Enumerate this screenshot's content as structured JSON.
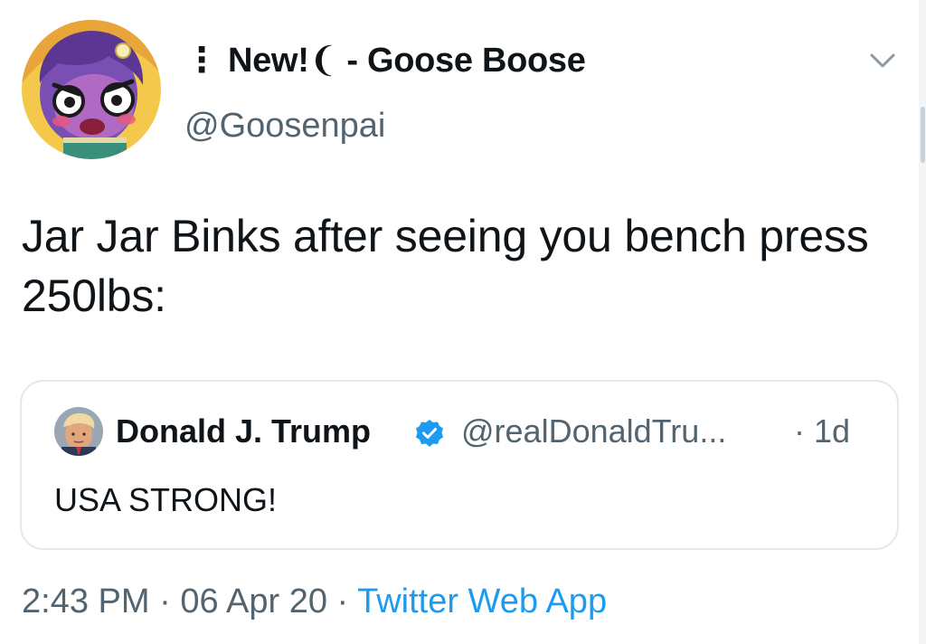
{
  "author": {
    "display_name": "⋮ New!❨ - Goose Boose",
    "handle": "@Goosenpai"
  },
  "tweet": {
    "text": "Jar Jar Binks after seeing you bench press 250lbs:"
  },
  "quoted_tweet": {
    "name": "Donald J. Trump",
    "handle": "@realDonaldTru...",
    "time": "· 1d",
    "text": "USA STRONG!"
  },
  "footer": {
    "time": "2:43 PM",
    "separator_1": " · ",
    "date": "06 Apr 20",
    "separator_2": " · ",
    "source": "Twitter Web App"
  },
  "colors": {
    "link_blue": "#1d9bf0",
    "muted_text": "#536471",
    "border": "#e3e8ec"
  },
  "icons": {
    "menu": "chevron-down-icon",
    "verified": "verified-badge-icon"
  }
}
